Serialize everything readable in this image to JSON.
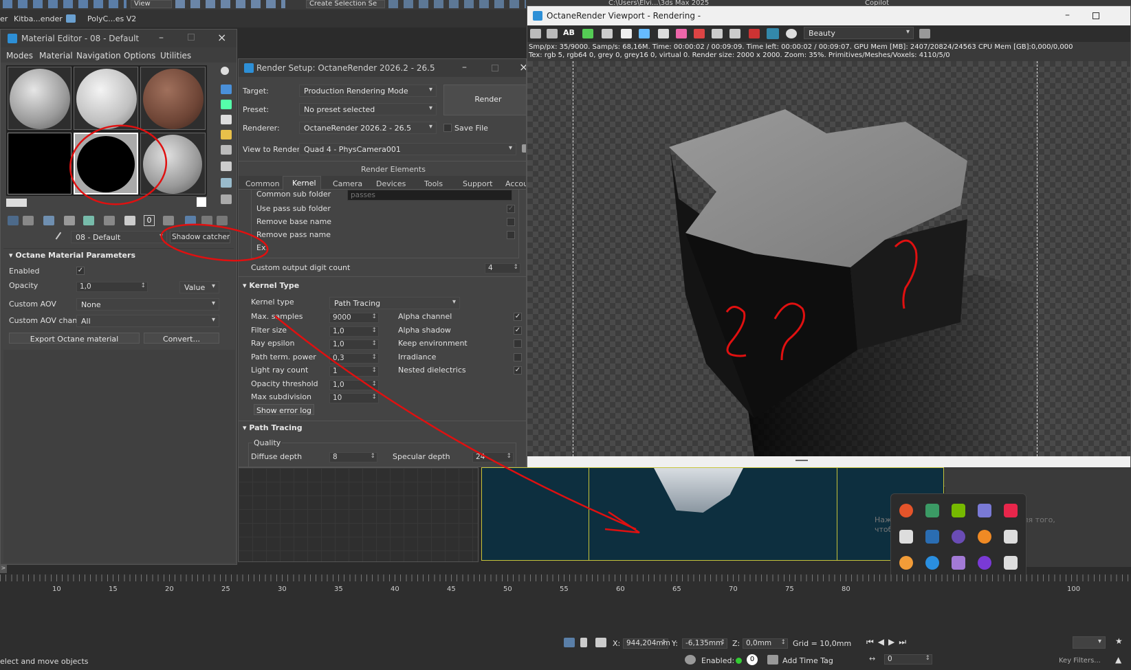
{
  "top_toolbar": {
    "view_label": "View",
    "create_selection_label": "Create Selection Se",
    "path_fragment": "C:\\Users\\Elvi...\\3ds Max 2025",
    "copilot_label": "Copilot",
    "second_row_left": "er",
    "kitbash_label": "Kitba...ender",
    "polyc_label": "PolyC...es V2"
  },
  "material_editor": {
    "title": "Material Editor - 08 - Default",
    "menu": [
      "Modes",
      "Material",
      "Navigation",
      "Options",
      "Utilities"
    ],
    "material_name": "08 - Default",
    "material_type": "Shadow catcher m",
    "rollout_title": "Octane Material Parameters",
    "enabled_label": "Enabled",
    "opacity_label": "Opacity",
    "opacity_value": "1,0",
    "opacity_mode": "Value",
    "custom_aov_label": "Custom AOV",
    "custom_aov_value": "None",
    "custom_aov_channel_label": "Custom AOV channel",
    "custom_aov_channel_value": "All",
    "export_button": "Export Octane material",
    "convert_button": "Convert..."
  },
  "render_setup": {
    "title": "Render Setup: OctaneRender 2026.2 - 26.5",
    "target_label": "Target:",
    "target_value": "Production Rendering Mode",
    "preset_label": "Preset:",
    "preset_value": "No preset selected",
    "renderer_label": "Renderer:",
    "renderer_value": "OctaneRender 2026.2 - 26.5",
    "save_file_label": "Save File",
    "view_label": "View to Render:",
    "view_value": "Quad 4 - PhysCamera001",
    "render_button": "Render",
    "render_elements": "Render Elements",
    "tabs": [
      "Common",
      "Kernel",
      "Camera",
      "Devices",
      "Tools",
      "Support",
      "Accou"
    ],
    "common_sub_folder": "Common sub folder",
    "common_sub_folder_value": "passes",
    "use_pass_sub_folder": "Use pass sub folder",
    "remove_base_name": "Remove base name",
    "remove_pass_name": "Remove pass name",
    "ex_label": "Ex:",
    "custom_output_digit_count": "Custom output digit count",
    "custom_output_digit_value": "4",
    "kernel_type_section": "Kernel Type",
    "kernel_type_label": "Kernel type",
    "kernel_type_value": "Path Tracing",
    "left_params": [
      {
        "label": "Max. samples",
        "value": "9000"
      },
      {
        "label": "Filter size",
        "value": "1,0"
      },
      {
        "label": "Ray epsilon",
        "value": "1,0"
      },
      {
        "label": "Path term. power",
        "value": "0,3"
      },
      {
        "label": "Light ray count",
        "value": "1"
      },
      {
        "label": "Opacity threshold",
        "value": "1,0"
      },
      {
        "label": "Max subdivision",
        "value": "10"
      }
    ],
    "right_params": [
      {
        "label": "Alpha channel",
        "checked": "✓"
      },
      {
        "label": "Alpha shadow",
        "checked": "✓"
      },
      {
        "label": "Keep environment",
        "checked": ""
      },
      {
        "label": "Irradiance",
        "checked": ""
      },
      {
        "label": "Nested dielectrics",
        "checked": "✓"
      }
    ],
    "show_error_log": "Show error log",
    "path_tracing_section": "Path Tracing",
    "quality_label": "Quality",
    "diffuse_depth_label": "Diffuse depth",
    "diffuse_depth_value": "8",
    "specular_depth_label": "Specular depth",
    "specular_depth_value": "24"
  },
  "octane_viewport": {
    "title": "OctaneRender Viewport - Rendering -",
    "channel_value": "Beauty",
    "stats_line1": "Smp/px: 35/9000.   Samp/s: 68,16M.   Time: 00:00:02 / 00:09:09.   Time left: 00:00:02 / 00:09:07.   GPU Mem [MB]: 2407/20824/24563   CPU Mem [GB]:0,000/0,000",
    "stats_line2": "Tex: rgb 5, rgb64 0, grey 0, grey16 0, virtual 0.   Render size: 2000 x 2000.   Zoom: 35%.   Primitives/Meshes/Voxels: 4110/5/0"
  },
  "timeline": {
    "ticks": [
      "10",
      "15",
      "20",
      "25",
      "30",
      "35",
      "40",
      "45",
      "50",
      "55",
      "60",
      "65",
      "70",
      "75",
      "80",
      "100"
    ]
  },
  "status_bar": {
    "prompt": "elect and move objects",
    "x_label": "X:",
    "x_value": "944,204mm",
    "y_label": "Y:",
    "y_value": "-6,135mm",
    "z_label": "Z:",
    "z_value": "0,0mm",
    "grid": "Grid = 10,0mm",
    "enabled_label": "Enabled:",
    "enabled_value": "0",
    "add_time_tag": "Add Time Tag",
    "frame_value": "0"
  },
  "activation_watermark": "Нажмите \"Prnt Scrn\" на клавиатуре для того, чтобы сделать скриншот",
  "key_filters": "Key Filters...",
  "annotations": {
    "color": "#e01010"
  }
}
